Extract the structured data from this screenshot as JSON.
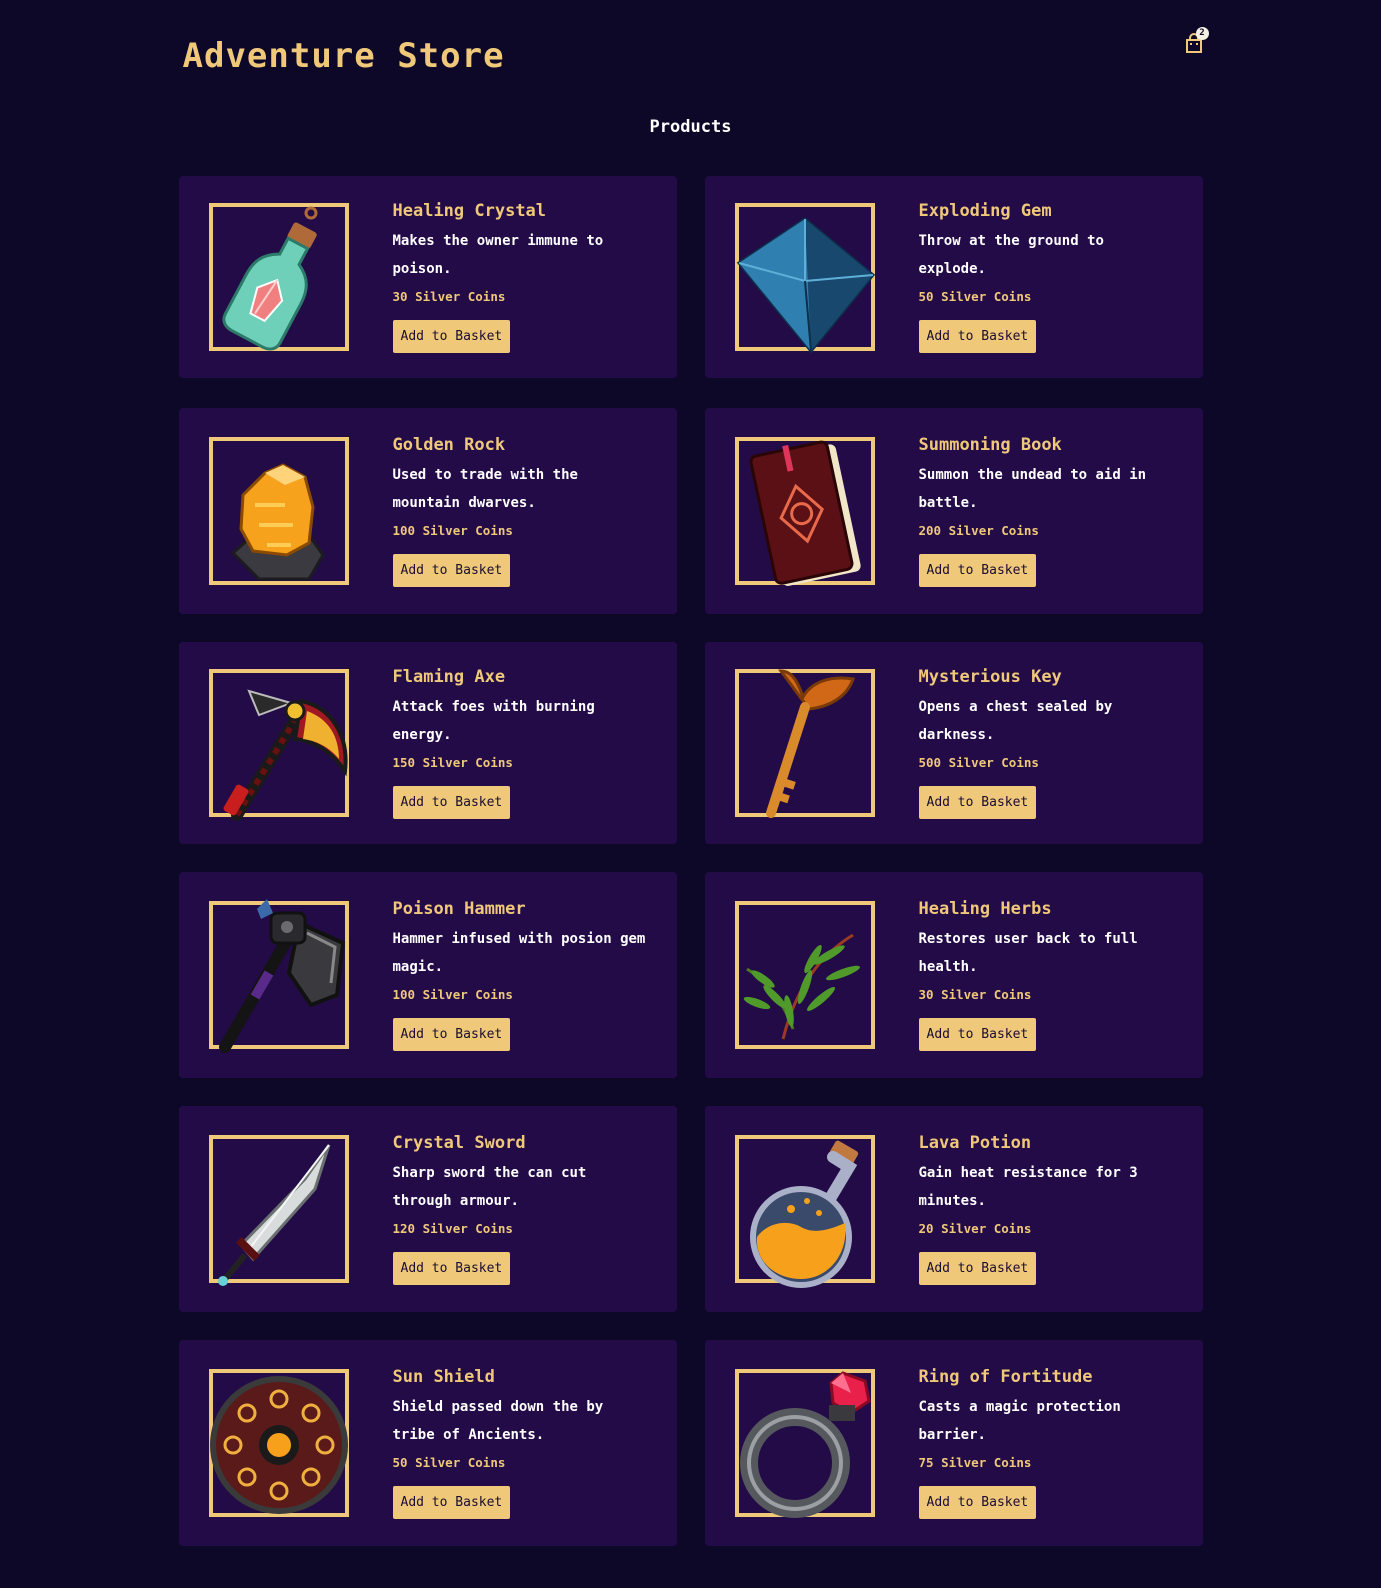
{
  "header": {
    "title": "Adventure Store",
    "cart_count": "2"
  },
  "products_heading": "Products",
  "products": [
    {
      "name": "Healing Crystal",
      "description": "Makes the owner immune to poison.",
      "price": "30 Silver Coins",
      "button": "Add to Basket"
    },
    {
      "name": "Exploding Gem",
      "description": "Throw at the ground to explode.",
      "price": "50 Silver Coins",
      "button": "Add to Basket"
    },
    {
      "name": "Golden Rock",
      "description": "Used to trade with the mountain dwarves.",
      "price": "100 Silver Coins",
      "button": "Add to Basket"
    },
    {
      "name": "Summoning Book",
      "description": "Summon the undead to aid in battle.",
      "price": "200 Silver Coins",
      "button": "Add to Basket"
    },
    {
      "name": "Flaming Axe",
      "description": "Attack foes with burning energy.",
      "price": "150 Silver Coins",
      "button": "Add to Basket"
    },
    {
      "name": "Mysterious Key",
      "description": "Opens a chest sealed by darkness.",
      "price": "500 Silver Coins",
      "button": "Add to Basket"
    },
    {
      "name": "Poison Hammer",
      "description": "Hammer infused with posion gem magic.",
      "price": "100 Silver Coins",
      "button": "Add to Basket"
    },
    {
      "name": "Healing Herbs",
      "description": "Restores user back to full health.",
      "price": "30 Silver Coins",
      "button": "Add to Basket"
    },
    {
      "name": "Crystal Sword",
      "description": "Sharp sword the can cut through armour.",
      "price": "120 Silver Coins",
      "button": "Add to Basket"
    },
    {
      "name": "Lava Potion",
      "description": "Gain heat resistance for 3 minutes.",
      "price": "20 Silver Coins",
      "button": "Add to Basket"
    },
    {
      "name": "Sun Shield",
      "description": "Shield passed down the by tribe of Ancients.",
      "price": "50 Silver Coins",
      "button": "Add to Basket"
    },
    {
      "name": "Ring of Fortitude",
      "description": "Casts a magic protection barrier.",
      "price": "75 Silver Coins",
      "button": "Add to Basket"
    }
  ],
  "colors": {
    "background": "#0e0828",
    "card": "#230b48",
    "accent": "#f0c879"
  }
}
